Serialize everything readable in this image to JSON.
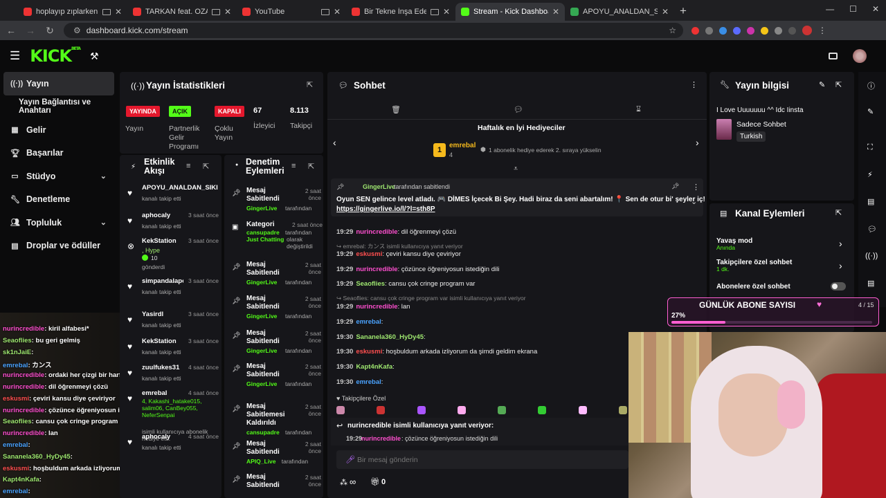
{
  "browser": {
    "tabs": [
      {
        "title": "hoplayıp zıplarken dinlenile",
        "active": false
      },
      {
        "title": "TARKAN feat. OZAN ÇOLAK",
        "active": false
      },
      {
        "title": "YouTube",
        "active": false
      },
      {
        "title": "Bir Tekne İnşa Edene Kadar Bir",
        "active": false
      },
      {
        "title": "Stream - Kick Dashboard",
        "active": true
      },
      {
        "title": "APOYU_ANALDAN_SIKEN Strea",
        "active": false
      }
    ],
    "url": "dashboard.kick.com/stream"
  },
  "app": {
    "logo": "KICK",
    "beta": "BETA"
  },
  "sidebar": {
    "items": [
      {
        "label": "Yayın",
        "icon": "broadcast-icon"
      },
      {
        "label": "Yayın Bağlantısı ve Anahtarı",
        "icon": ""
      },
      {
        "label": "Gelir",
        "icon": "revenue-icon"
      },
      {
        "label": "Başarılar",
        "icon": "trophy-icon"
      },
      {
        "label": "Stüdyo",
        "icon": "studio-icon"
      },
      {
        "label": "Denetleme",
        "icon": "wrench-icon"
      },
      {
        "label": "Topluluk",
        "icon": "community-icon"
      },
      {
        "label": "Droplar ve ödüller",
        "icon": "drops-icon"
      }
    ]
  },
  "stats": {
    "title": "Yayın İstatistikleri",
    "badges": [
      {
        "text": "YAYINDA",
        "color": "#e4182d"
      },
      {
        "text": "AÇIK",
        "color": "#53fc18"
      },
      {
        "text": "KAPALI",
        "color": "#e4182d"
      }
    ],
    "labels": [
      "Yayın",
      "Partnerlik Gelir Programı",
      "Çoklu Yayın"
    ],
    "viewers": "67",
    "viewers_label": "İzleyici",
    "followers": "8.113",
    "followers_label": "Takipçi"
  },
  "activity": {
    "title": "Etkinlik Akışı",
    "items": [
      {
        "name": "APOYU_ANALDAN_SIKI",
        "sub": "kanalı takip etti",
        "time": ""
      },
      {
        "name": "aphocaly",
        "sub": "kanalı takip etti",
        "time": "3 saat önce"
      },
      {
        "name": "KekStation",
        "extra": ", Hype",
        "count": "10",
        "sub": "gönderdi",
        "time": "3 saat önce"
      },
      {
        "name": "simpandalapodo",
        "sub": "kanalı takip etti",
        "time": "3 saat önce"
      },
      {
        "name": "Yasirdl",
        "sub": "kanalı takip etti",
        "time": "3 saat önce"
      },
      {
        "name": "KekStation",
        "sub": "kanalı takip etti",
        "time": "3 saat önce"
      },
      {
        "name": "zuulfukes31",
        "sub": "kanalı takip etti",
        "time": "4 saat önce"
      },
      {
        "name": "emrebal",
        "list": "4, Kakashi_hatake015, salim06, CanBey055, NeferSenpai",
        "sub": "isimli kullanıcıya abonelik hediye etti.",
        "time": "4 saat önce"
      },
      {
        "name": "aphocaly",
        "sub": "kanalı takip etti",
        "time": "4 saat önce"
      }
    ]
  },
  "moderation": {
    "title": "Denetim Eylemleri",
    "items": [
      {
        "title": "Mesaj Sabitlendi",
        "user": "GingerLive",
        "by": "tarafından",
        "time": "2 saat önce"
      },
      {
        "title": "Kategori",
        "user": "cansupadre",
        "by": "tarafından",
        "detail": "Just Chatting",
        "detail2": "olarak değiştirildi",
        "time": "2 saat önce"
      },
      {
        "title": "Mesaj Sabitlendi",
        "user": "GingerLive",
        "by": "tarafından",
        "time": "2 saat önce"
      },
      {
        "title": "Mesaj Sabitlendi",
        "user": "GingerLive",
        "by": "tarafından",
        "time": "2 saat önce"
      },
      {
        "title": "Mesaj Sabitlendi",
        "user": "GingerLive",
        "by": "tarafından",
        "time": "2 saat önce"
      },
      {
        "title": "Mesaj Sabitlendi",
        "user": "GingerLive",
        "by": "tarafından",
        "time": "2 saat önce"
      },
      {
        "title": "Mesaj Sabitlemesi Kaldırıldı",
        "user": "cansupadre",
        "by": "tarafından",
        "time": "2 saat önce"
      },
      {
        "title": "Mesaj Sabitlendi",
        "user": "APIQ_Live",
        "by": "tarafından",
        "time": "2 saat önce"
      },
      {
        "title": "Mesaj Sabitlendi",
        "user": "",
        "by": "",
        "time": "2 saat önce"
      }
    ]
  },
  "chat": {
    "title": "Sohbet",
    "gifters_title": "Haftalık en İyi Hediyeciler",
    "top_gifter": "emrebal",
    "top_count": "4",
    "gifter_note": "1 abonelik hediye ederek 2. sıraya yükselin",
    "pinned_by": "GingerLive",
    "pinned_by_suffix": "tarafından sabitlendi",
    "pinned_text": "Oyun SEN gelince level atladı. 🎮 DİMES İçecek Bi Şey. Hadi biraz da seni abartalım! 📍 Sen de otur bi' şeyler iç!",
    "pinned_link": "https://gingerlive.io/l/?l=sth8P",
    "messages": [
      {
        "ts": "19:29",
        "user": "nurincredible",
        "color": "#ff4fcf",
        "text": ": dil öğrenmeyi çözü"
      },
      {
        "reply": "emrebal: カンス isimli kullanıcıya yanıt veriyor"
      },
      {
        "ts": "19:29",
        "user": "eskusmi",
        "color": "#ff4f4f",
        "text": ": çeviri kansu diye çeviriyor"
      },
      {
        "ts": "19:29",
        "user": "nurincredible",
        "color": "#ff4fcf",
        "text": ": çözünce öğreniyosun istediğin dili"
      },
      {
        "ts": "19:29",
        "user": "Seaoflies",
        "color": "#9fe870",
        "text": ": cansu çok cringe program var"
      },
      {
        "reply": "Seaoflies: cansu çok cringe program var isimli kullanıcıya yanıt veriyor"
      },
      {
        "ts": "19:29",
        "user": "nurincredible",
        "color": "#ff4fcf",
        "text": ": lan"
      },
      {
        "ts": "19:29",
        "user": "emrebal",
        "color": "#4aa3ff",
        "text": ":"
      },
      {
        "ts": "19:30",
        "user": "Sananela360_HyDy45",
        "color": "#9fe870",
        "text": ":"
      },
      {
        "ts": "19:30",
        "user": "eskusmi",
        "color": "#ff4f4f",
        "text": ": hoşbuldum arkada izliyorum da şimdi geldim ekrana"
      },
      {
        "ts": "19:30",
        "user": "Kapt4nKafa",
        "color": "#9fe870",
        "text": ":"
      },
      {
        "ts": "19:30",
        "user": "emrebal",
        "color": "#4aa3ff",
        "text": ":"
      }
    ],
    "emote_label": "Takipçilere Özel",
    "reply_to": "nurincredible isimli kullanıcıya yanıt veriyor:",
    "reply_ts": "19:29",
    "reply_user": "nurincredible",
    "reply_text": ": çözünce öğreniyosun istediğin dili",
    "input_placeholder": "Bir mesaj gönderin",
    "points": "∞",
    "gift_count": "0"
  },
  "info": {
    "title": "Yayın bilgisi",
    "stream_title": "I Love Uuuuuuu ^^ Idc Iinsta",
    "category": "Sadece Sohbet",
    "tag": "Turkish"
  },
  "channel": {
    "title": "Kanal Eylemleri",
    "items": [
      {
        "label": "Yavaş mod",
        "sub": "Anında"
      },
      {
        "label": "Takipçilere özel sohbet",
        "sub": "1 dk."
      },
      {
        "label": "Abonelere özel sohbet",
        "sub": ""
      }
    ]
  },
  "overlay": {
    "title": "GÜNLÜK ABONE SAYISI",
    "percent": "27%",
    "count": "4 / 15",
    "progress": 0.27
  },
  "overlay_chat": [
    {
      "user": "nurincredible",
      "color": "#ff4fcf",
      "text": ": kiril alfabesi*"
    },
    {
      "user": "Seaoflies",
      "color": "#9fe870",
      "text": ": bu geri gelmiş"
    },
    {
      "user": "sk1nJaiE",
      "color": "#9fe870",
      "text": ":"
    },
    {
      "user": "emrebal",
      "color": "#4aa3ff",
      "text": ": カンス"
    },
    {
      "user": "nurincredible",
      "color": "#ff4fcf",
      "text": ": ordaki her çizgi bir harf"
    },
    {
      "user": "nurincredible",
      "color": "#ff4fcf",
      "text": ": dil öğrenmeyi çözü"
    },
    {
      "user": "eskusmi",
      "color": "#ff4f4f",
      "text": ": çeviri kansu diye çeviriyor"
    },
    {
      "user": "nurincredible",
      "color": "#ff4fcf",
      "text": ": çözünce öğreniyosun istediğin dili"
    },
    {
      "user": "Seaoflies",
      "color": "#9fe870",
      "text": ": cansu çok cringe program var"
    },
    {
      "user": "nurincredible",
      "color": "#ff4fcf",
      "text": ": lan"
    },
    {
      "user": "emrebal",
      "color": "#4aa3ff",
      "text": ":"
    },
    {
      "user": "Sananela360_HyDy45",
      "color": "#9fe870",
      "text": ":"
    },
    {
      "user": "eskusmi",
      "color": "#ff4f4f",
      "text": ": hoşbuldum arkada izliyorum da şimdi geldim ekrana"
    },
    {
      "user": "Kapt4nKafa",
      "color": "#9fe870",
      "text": ":"
    },
    {
      "user": "emrebal",
      "color": "#4aa3ff",
      "text": ":"
    }
  ]
}
